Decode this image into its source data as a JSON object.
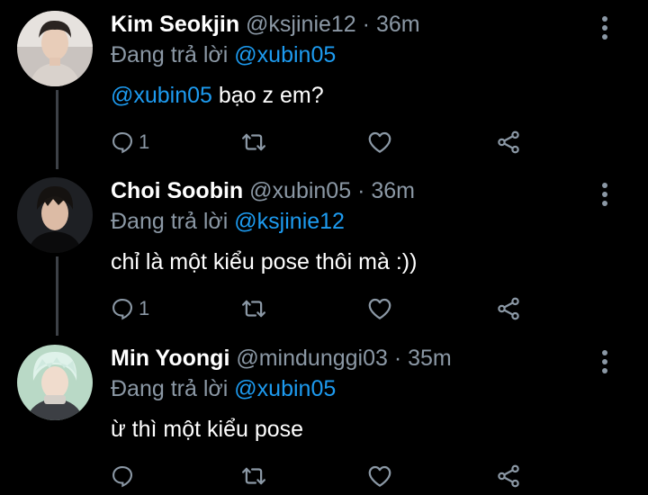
{
  "colors": {
    "background": "#000000",
    "secondary_text": "#8b98a5",
    "mention": "#1d9bf0",
    "thread_line": "#3d4147"
  },
  "replying_prefix": "Đang trả lời",
  "tweets": [
    {
      "name": "Kim Seokjin",
      "handle": "@ksjinie12",
      "separator": "·",
      "time": "36m",
      "reply_to": "@xubin05",
      "body_mention": "@xubin05",
      "body_text": " bạo z em?",
      "reply_count": "1",
      "avatar": "avatar-photo"
    },
    {
      "name": "Choi Soobin",
      "handle": "@xubin05",
      "separator": "·",
      "time": "36m",
      "reply_to": "@ksjinie12",
      "body_mention": "",
      "body_text": "chỉ là một kiểu pose thôi mà :))",
      "reply_count": "1",
      "avatar": "avatar-photo"
    },
    {
      "name": "Min Yoongi",
      "handle": "@mindunggi03",
      "separator": "·",
      "time": "35m",
      "reply_to": "@xubin05",
      "body_mention": "",
      "body_text": "ừ thì một kiểu pose",
      "reply_count": "",
      "avatar": "avatar-photo"
    }
  ],
  "icons": [
    "reply-icon",
    "retweet-icon",
    "like-icon",
    "share-icon",
    "more-options-icon"
  ]
}
